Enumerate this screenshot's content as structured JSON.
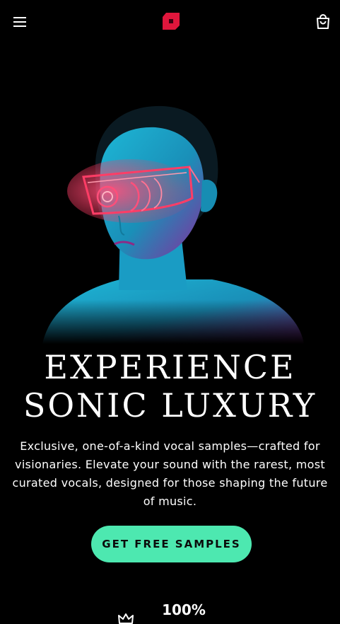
{
  "header": {
    "menu_icon": "hamburger-menu-icon",
    "logo_icon": "brand-logo-icon",
    "cart_icon": "shopping-bag-icon",
    "logo_color": "#e0163c"
  },
  "hero": {
    "headline_line1": "EXPERIENCE",
    "headline_line2": "SONIC LUXURY",
    "subtext": "Exclusive, one-of-a-kind vocal samples—crafted for visionaries. Elevate your sound with the rarest, most curated vocals, designed for those shaping the future of music.",
    "cta_label": "GET FREE SAMPLES",
    "cta_color": "#4de8b0"
  },
  "stats": {
    "first_value": "100%",
    "first_icon": "crown-icon"
  }
}
